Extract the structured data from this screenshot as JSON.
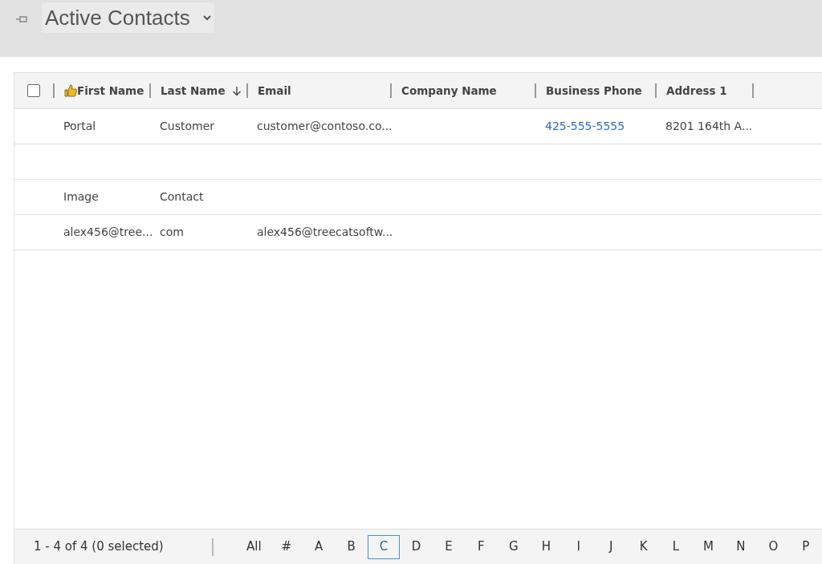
{
  "view": {
    "title": "Active Contacts"
  },
  "table": {
    "select_all": {
      "checked": false
    },
    "columns": [
      {
        "label": "First Name",
        "kind": "thumb"
      },
      {
        "label": "Last Name",
        "kind": "sorted"
      },
      {
        "label": "Email",
        "kind": "plain"
      },
      {
        "label": "Company Name",
        "kind": "plain"
      },
      {
        "label": "Business Phone",
        "kind": "plain"
      },
      {
        "label": "Address 1",
        "kind": "plain"
      }
    ],
    "rows": [
      {
        "kind": "data",
        "cells": [
          {
            "text": "Portal",
            "kind": "text"
          },
          {
            "text": "Customer",
            "kind": "text"
          },
          {
            "text": "customer@contoso.co...",
            "kind": "text"
          },
          {
            "kind": "empty"
          },
          {
            "text": "425-555-5555",
            "kind": "link"
          },
          {
            "text": "8201 164th A...",
            "kind": "text"
          }
        ]
      },
      {
        "kind": "blank"
      },
      {
        "kind": "data",
        "cells": [
          {
            "text": "Image",
            "kind": "text"
          },
          {
            "text": "Contact",
            "kind": "text"
          }
        ]
      },
      {
        "kind": "data",
        "cells": [
          {
            "text": "alex456@tree...",
            "kind": "text"
          },
          {
            "text": "com",
            "kind": "text"
          },
          {
            "text": "alex456@treecatsoftw...",
            "kind": "text"
          }
        ]
      }
    ]
  },
  "footer": {
    "record_count": "1 - 4 of 4 (0 selected)",
    "letters": [
      {
        "label": "All",
        "selected": false
      },
      {
        "label": "#",
        "selected": false
      },
      {
        "label": "A",
        "selected": false
      },
      {
        "label": "B",
        "selected": false
      },
      {
        "label": "C",
        "selected": true
      },
      {
        "label": "D",
        "selected": false
      },
      {
        "label": "E",
        "selected": false
      },
      {
        "label": "F",
        "selected": false
      },
      {
        "label": "G",
        "selected": false
      },
      {
        "label": "H",
        "selected": false
      },
      {
        "label": "I",
        "selected": false
      },
      {
        "label": "J",
        "selected": false
      },
      {
        "label": "K",
        "selected": false
      },
      {
        "label": "L",
        "selected": false
      },
      {
        "label": "M",
        "selected": false
      },
      {
        "label": "N",
        "selected": false
      },
      {
        "label": "O",
        "selected": false
      },
      {
        "label": "P",
        "selected": false
      }
    ]
  }
}
